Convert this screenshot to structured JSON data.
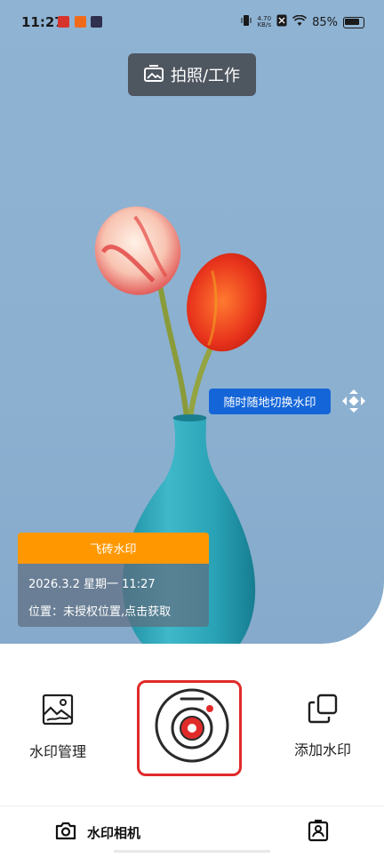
{
  "status_bar": {
    "time": "11:27",
    "net_speed_value": "4.70",
    "net_speed_unit": "KB/s",
    "battery": "85%"
  },
  "mode_button": {
    "label": "拍照/工作"
  },
  "switch_watermark": {
    "label": "随时随地切换水印"
  },
  "watermark": {
    "title": "飞砖水印",
    "datetime": "2026.3.2 星期一 11:27",
    "location": "位置：未授权位置,点击获取"
  },
  "controls": {
    "manage_label": "水印管理",
    "add_label": "添加水印"
  },
  "bottom_nav": {
    "camera_label": "水印相机"
  },
  "colors": {
    "sky": "#8fb3d3",
    "chip_blue": "#1466d8",
    "watermark_orange": "#ff9800",
    "highlight_red": "#e02a2a"
  }
}
